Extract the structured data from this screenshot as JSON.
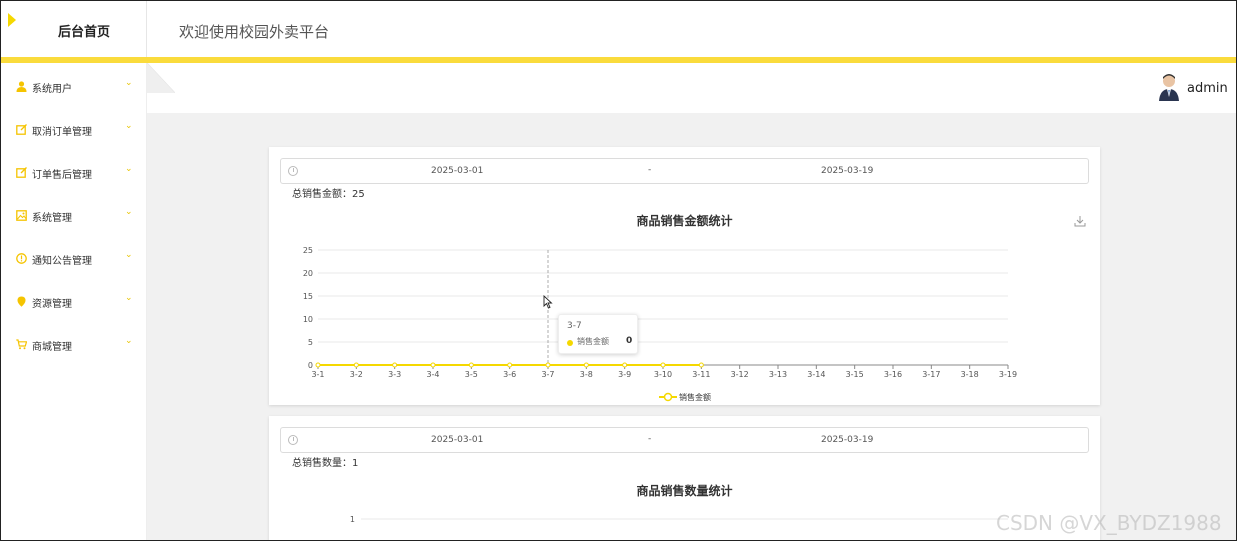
{
  "header": {
    "brand_title": "后台首页",
    "site_title": "欢迎使用校园外卖平台"
  },
  "colors": {
    "accent": "#fadb3c",
    "series": "#f5d800"
  },
  "sidebar": {
    "items": [
      {
        "label": "系统用户",
        "icon": "user-icon"
      },
      {
        "label": "取消订单管理",
        "icon": "order-icon"
      },
      {
        "label": "订单售后管理",
        "icon": "order-icon"
      },
      {
        "label": "系统管理",
        "icon": "image-icon"
      },
      {
        "label": "通知公告管理",
        "icon": "info-icon"
      },
      {
        "label": "资源管理",
        "icon": "location-icon"
      },
      {
        "label": "商城管理",
        "icon": "cart-icon"
      }
    ]
  },
  "user": {
    "name": "admin"
  },
  "sales_amount": {
    "start_date": "2025-03-01",
    "separator": "-",
    "end_date": "2025-03-19",
    "total_label": "总销售金额：25",
    "tooltip": {
      "title": "3-7",
      "series": "销售金额",
      "value": "0"
    }
  },
  "sales_quantity": {
    "start_date": "2025-03-01",
    "separator": "-",
    "end_date": "2025-03-19",
    "total_label": "总销售数量：1"
  },
  "chart_data": [
    {
      "type": "line",
      "title": "商品销售金额统计",
      "x": [
        "3-1",
        "3-2",
        "3-3",
        "3-4",
        "3-5",
        "3-6",
        "3-7",
        "3-8",
        "3-9",
        "3-10",
        "3-11",
        "3-12",
        "3-13",
        "3-14",
        "3-15",
        "3-16",
        "3-17",
        "3-18",
        "3-19"
      ],
      "series": [
        {
          "name": "销售金额",
          "values": [
            0,
            0,
            0,
            0,
            0,
            0,
            0,
            0,
            0,
            0,
            0,
            null,
            null,
            null,
            null,
            null,
            null,
            null,
            null
          ]
        }
      ],
      "yticks": [
        "0",
        "5",
        "10",
        "15",
        "20",
        "25"
      ],
      "ylim": [
        0,
        25
      ],
      "grid": true,
      "legend": "bottom-center"
    },
    {
      "type": "line",
      "title": "商品销售数量统计",
      "yticks": [
        "1"
      ],
      "series": []
    }
  ],
  "watermark": "CSDN @VX_BYDZ1988"
}
